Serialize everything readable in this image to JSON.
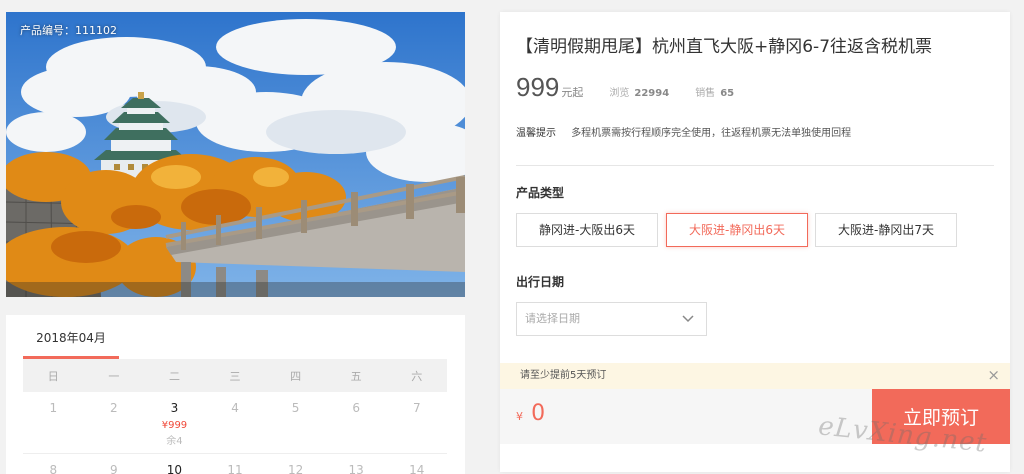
{
  "photo": {
    "product_code": "产品编号：111102"
  },
  "calendar": {
    "month": "2018年04月",
    "weekdays": [
      "日",
      "一",
      "二",
      "三",
      "四",
      "五",
      "六"
    ],
    "week1": [
      "1",
      "2",
      "3",
      "4",
      "5",
      "6",
      "7"
    ],
    "week2": [
      "8",
      "9",
      "10",
      "11",
      "12",
      "13",
      "14"
    ],
    "selected_day": {
      "price": "¥999",
      "stock": "余4"
    }
  },
  "detail": {
    "title": "【清明假期甩尾】杭州直飞大阪+静冈6-7往返含税机票",
    "price": "999",
    "price_unit": "元起",
    "views_label": "浏览",
    "views": "22994",
    "sales_label": "销售",
    "sales": "65",
    "notice_label": "温馨提示",
    "notice_text": "多程机票需按行程顺序完全使用，往返程机票无法单独使用回程",
    "type_label": "产品类型",
    "options": [
      "静冈进-大阪出6天",
      "大阪进-静冈出6天",
      "大阪进-静冈出7天"
    ],
    "selected_option": 1,
    "date_label": "出行日期",
    "date_placeholder": "请选择日期",
    "tip": "请至少提前5天预订",
    "tip_close": "×",
    "total_symbol": "¥",
    "total": "0",
    "book_label": "立即预订"
  },
  "watermark": "eLvXing.net",
  "colors": {
    "accent": "#f26a5a",
    "price_red": "#f04a3a",
    "tip_bg": "#fdf6e3"
  }
}
